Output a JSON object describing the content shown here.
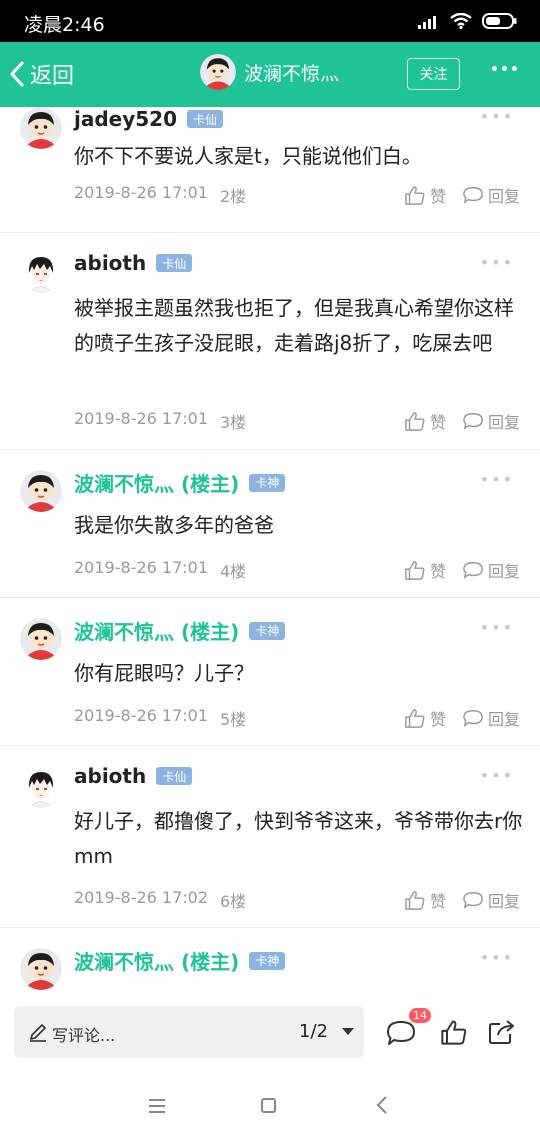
{
  "status_bar": {
    "time": "凌晨2:46"
  },
  "header": {
    "back_label": "返回",
    "title": "波澜不惊灬",
    "follow_label": "关注"
  },
  "posts": [
    {
      "username": "jadey520",
      "badge": "卡仙",
      "is_owner": false,
      "avatar": "cartoon-boy",
      "text": "你不下不要说人家是t，只能说他们白。",
      "timestamp": "2019-8-26 17:01",
      "floor": "2楼",
      "like_label": "赞",
      "reply_label": "回复"
    },
    {
      "username": "abioth",
      "badge": "卡仙",
      "is_owner": false,
      "avatar": "anime-boy",
      "text": "被举报主题虽然我也拒了，但是我真心希望你这样的喷子生孩子没屁眼，走着路j8折了，吃屎去吧",
      "timestamp": "2019-8-26 17:01",
      "floor": "3楼",
      "like_label": "赞",
      "reply_label": "回复"
    },
    {
      "username": "波澜不惊灬 (楼主)",
      "badge": "卡神",
      "is_owner": true,
      "avatar": "cartoon-boy",
      "text": "我是你失散多年的爸爸",
      "timestamp": "2019-8-26 17:01",
      "floor": "4楼",
      "like_label": "赞",
      "reply_label": "回复"
    },
    {
      "username": "波澜不惊灬 (楼主)",
      "badge": "卡神",
      "is_owner": true,
      "avatar": "cartoon-boy",
      "text": "你有屁眼吗？儿子？",
      "timestamp": "2019-8-26 17:01",
      "floor": "5楼",
      "like_label": "赞",
      "reply_label": "回复"
    },
    {
      "username": "abioth",
      "badge": "卡仙",
      "is_owner": false,
      "avatar": "anime-boy",
      "text": "好儿子，都撸傻了，快到爷爷这来，爷爷带你去r你mm",
      "timestamp": "2019-8-26 17:02",
      "floor": "6楼",
      "like_label": "赞",
      "reply_label": "回复"
    },
    {
      "username": "波澜不惊灬 (楼主)",
      "badge": "卡神",
      "is_owner": true,
      "avatar": "cartoon-boy",
      "text": "",
      "timestamp": "",
      "floor": "",
      "like_label": "",
      "reply_label": ""
    }
  ],
  "bottom_bar": {
    "comment_placeholder": "写评论...",
    "page_indicator": "1/2",
    "comment_count": "14"
  },
  "colors": {
    "accent": "#1fc396",
    "badge": "#8bb4e0",
    "notification": "#ff5a5f"
  }
}
